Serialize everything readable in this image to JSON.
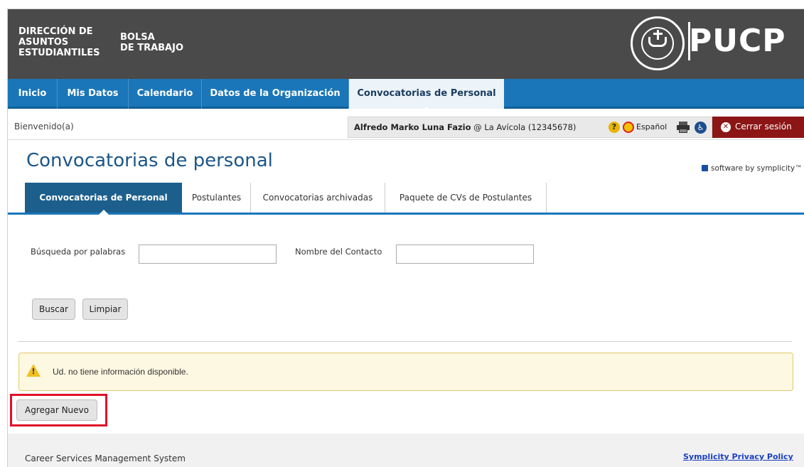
{
  "header": {
    "brand_left_lines": [
      "DIRECCIÓN DE",
      "ASUNTOS",
      "ESTUDIANTILES"
    ],
    "brand_right_lines": [
      "BOLSA",
      "DE TRABAJO"
    ],
    "logo_text": "PUCP"
  },
  "main_nav": {
    "tabs": [
      {
        "label": "Inicio",
        "active": false
      },
      {
        "label": "Mis Datos",
        "active": false
      },
      {
        "label": "Calendario",
        "active": false
      },
      {
        "label": "Datos de la Organización",
        "active": false
      },
      {
        "label": "Convocatorias de Personal",
        "active": true
      }
    ]
  },
  "welcome": {
    "greeting": "Bienvenido(a)",
    "user_name": "Alfredo Marko Luna Fazio",
    "user_org": "@ La Avícola (12345678)",
    "language": "Español",
    "logout_label": "Cerrar sesión"
  },
  "page": {
    "title": "Convocatorias de personal",
    "vendor": "software by symplicity™"
  },
  "sub_tabs": [
    {
      "label": "Convocatorias de Personal",
      "active": true
    },
    {
      "label": "Postulantes",
      "active": false
    },
    {
      "label": "Convocatorias archivadas",
      "active": false
    },
    {
      "label": "Paquete de CVs de Postulantes",
      "active": false
    }
  ],
  "search": {
    "keyword_label": "Búsqueda por palabras",
    "keyword_value": "",
    "contact_label": "Nombre del Contacto",
    "contact_value": "",
    "search_button": "Buscar",
    "clear_button": "Limpiar"
  },
  "alert": {
    "message": "Ud. no tiene información disponible."
  },
  "actions": {
    "add_new_label": "Agregar Nuevo"
  },
  "footer": {
    "left_text": "Career Services Management System",
    "privacy_link": "Symplicity Privacy Policy"
  },
  "colors": {
    "header_bg": "#4a4a4a",
    "nav_blue": "#1a76b8",
    "active_subtab": "#1c5f8d",
    "logout_red": "#8c1515",
    "highlight_red": "#e0102a"
  }
}
